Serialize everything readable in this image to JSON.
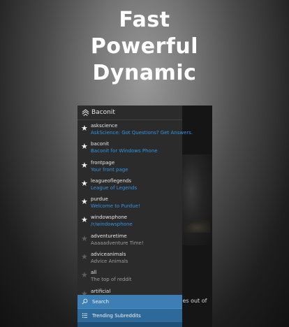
{
  "tagline": [
    "Fast",
    "Powerful",
    "Dynamic"
  ],
  "app": {
    "title": "Baconit"
  },
  "subreddits": [
    {
      "name": "askscience",
      "desc": "AskScience: Got Questions? Get Answers.",
      "favorite": true
    },
    {
      "name": "baconit",
      "desc": "Baconit for Windows Phone",
      "favorite": true
    },
    {
      "name": "frontpage",
      "desc": "Your front page",
      "favorite": true
    },
    {
      "name": "leagueoflegends",
      "desc": "League of Legends",
      "favorite": true
    },
    {
      "name": "purdue",
      "desc": "Welcome to Purdue!",
      "favorite": true
    },
    {
      "name": "windowsphone",
      "desc": "/r/windowsphone",
      "favorite": true
    },
    {
      "name": "adventuretime",
      "desc": "Aaaaadventure Time!",
      "favorite": false
    },
    {
      "name": "adviceanimals",
      "desc": "Advice Animals",
      "favorite": false
    },
    {
      "name": "all",
      "desc": "The top of reddit",
      "favorite": false
    },
    {
      "name": "artificial",
      "desc": "",
      "favorite": false
    }
  ],
  "bottom": {
    "search_label": "Search",
    "trending_label": "Trending Subreddits"
  },
  "background_post": {
    "peek_text": "iles out of"
  },
  "colors": {
    "accent": "#2f95e6",
    "search_bar": "#3d7fb5",
    "trending_bar": "#2e6a99",
    "drawer_bg": "#2b2b2b"
  },
  "icons": {
    "logo": "baconit-logo-icon",
    "favorite": "star-icon",
    "search": "search-icon",
    "trending": "list-icon"
  }
}
